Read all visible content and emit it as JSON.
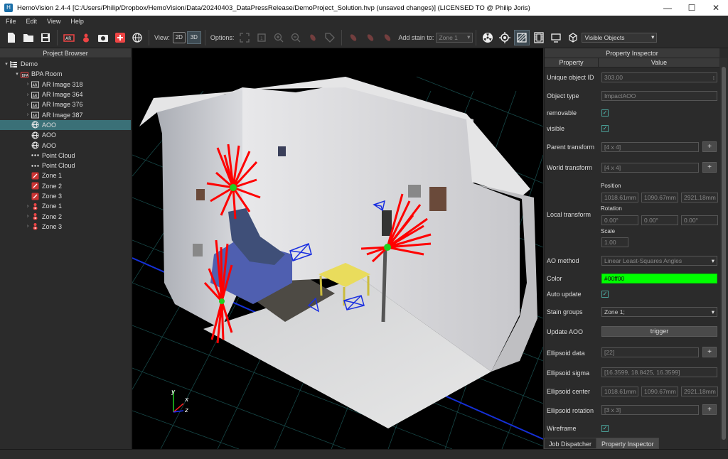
{
  "window": {
    "title": "HemoVision 2.4-4 [C:/Users/Philip/Dropbox/HemoVision/Data/20240403_DataPressRelease/DemoProject_Solution.hvp (unsaved changes)] (LICENSED TO @ Philip Joris)",
    "minimize": "—",
    "maximize": "☐",
    "close": "✕"
  },
  "menu": {
    "file": "File",
    "edit": "Edit",
    "view": "View",
    "help": "Help"
  },
  "toolbar": {
    "view_label": "View:",
    "btn_2d": "2D",
    "btn_3d": "3D",
    "options_label": "Options:",
    "add_stain_label": "Add stain to:",
    "zone_select": "Zone 1",
    "visible_select": "Visible Objects"
  },
  "project_browser": {
    "title": "Project Browser",
    "items": [
      {
        "label": "Demo",
        "indent": 0,
        "arrow": "▾",
        "icon": "project-icon",
        "selected": false
      },
      {
        "label": "BPA Room",
        "indent": 1,
        "arrow": "▾",
        "icon": "room-icon",
        "selected": false
      },
      {
        "label": "AR Image 318",
        "indent": 2,
        "arrow": "›",
        "icon": "ar-image-icon",
        "selected": false
      },
      {
        "label": "AR Image 364",
        "indent": 2,
        "arrow": "›",
        "icon": "ar-image-icon",
        "selected": false
      },
      {
        "label": "AR Image 376",
        "indent": 2,
        "arrow": "›",
        "icon": "ar-image-icon",
        "selected": false
      },
      {
        "label": "AR Image 387",
        "indent": 2,
        "arrow": "›",
        "icon": "ar-image-icon",
        "selected": false
      },
      {
        "label": "AOO",
        "indent": 2,
        "arrow": "",
        "icon": "globe-icon",
        "selected": true
      },
      {
        "label": "AOO",
        "indent": 2,
        "arrow": "",
        "icon": "globe-icon",
        "selected": false
      },
      {
        "label": "AOO",
        "indent": 2,
        "arrow": "",
        "icon": "globe-icon",
        "selected": false
      },
      {
        "label": "Point Cloud",
        "indent": 2,
        "arrow": "",
        "icon": "point-cloud-icon",
        "selected": false
      },
      {
        "label": "Point Cloud",
        "indent": 2,
        "arrow": "",
        "icon": "point-cloud-icon",
        "selected": false
      },
      {
        "label": "Zone 1",
        "indent": 2,
        "arrow": "",
        "icon": "zone-icon",
        "selected": false
      },
      {
        "label": "Zone 2",
        "indent": 2,
        "arrow": "",
        "icon": "zone-icon",
        "selected": false
      },
      {
        "label": "Zone 3",
        "indent": 2,
        "arrow": "",
        "icon": "zone-icon",
        "selected": false
      },
      {
        "label": "Zone 1",
        "indent": 2,
        "arrow": "›",
        "icon": "stain-zone-icon",
        "selected": false
      },
      {
        "label": "Zone 2",
        "indent": 2,
        "arrow": "›",
        "icon": "stain-zone-icon",
        "selected": false
      },
      {
        "label": "Zone 3",
        "indent": 2,
        "arrow": "›",
        "icon": "stain-zone-icon",
        "selected": false
      }
    ]
  },
  "inspector": {
    "title": "Property Inspector",
    "col_property": "Property",
    "col_value": "Value",
    "unique_id_label": "Unique object ID",
    "unique_id": "303.00",
    "object_type_label": "Object type",
    "object_type": "ImpactAOO",
    "removable_label": "removable",
    "visible_label": "visible",
    "parent_transform_label": "Parent transform",
    "parent_transform": "[4 x 4]",
    "world_transform_label": "World transform",
    "world_transform": "[4 x 4]",
    "local_transform_label": "Local transform",
    "position_label": "Position",
    "pos_x": "1018.61mm",
    "pos_y": "1090.67mm",
    "pos_z": "2921.18mm",
    "rotation_label": "Rotation",
    "rot_x": "0.00°",
    "rot_y": "0.00°",
    "rot_z": "0.00°",
    "scale_label": "Scale",
    "scale": "1.00",
    "ao_method_label": "AO method",
    "ao_method": "Linear Least-Squares Angles",
    "color_label": "Color",
    "color": "#00ff00",
    "auto_update_label": "Auto update",
    "stain_groups_label": "Stain groups",
    "stain_groups": "Zone 1;",
    "update_aoo_label": "Update AOO",
    "trigger": "trigger",
    "ellipsoid_data_label": "Ellipsoid data",
    "ellipsoid_data": "[22]",
    "ellipsoid_sigma_label": "Ellipsoid sigma",
    "ellipsoid_sigma": "[16.3599, 18.8425, 16.3599]",
    "ellipsoid_center_label": "Ellipsoid center",
    "center_x": "1018.61mm",
    "center_y": "1090.67mm",
    "center_z": "2921.18mm",
    "ellipsoid_rotation_label": "Ellipsoid rotation",
    "ellipsoid_rotation": "[3 x 3]",
    "wireframe_label": "Wireframe",
    "plus": "+",
    "check": "✓"
  },
  "axes": {
    "x": "x",
    "y": "y",
    "z": "z"
  },
  "tabs": {
    "job_dispatcher": "Job Dispatcher",
    "property_inspector": "Property Inspector"
  }
}
